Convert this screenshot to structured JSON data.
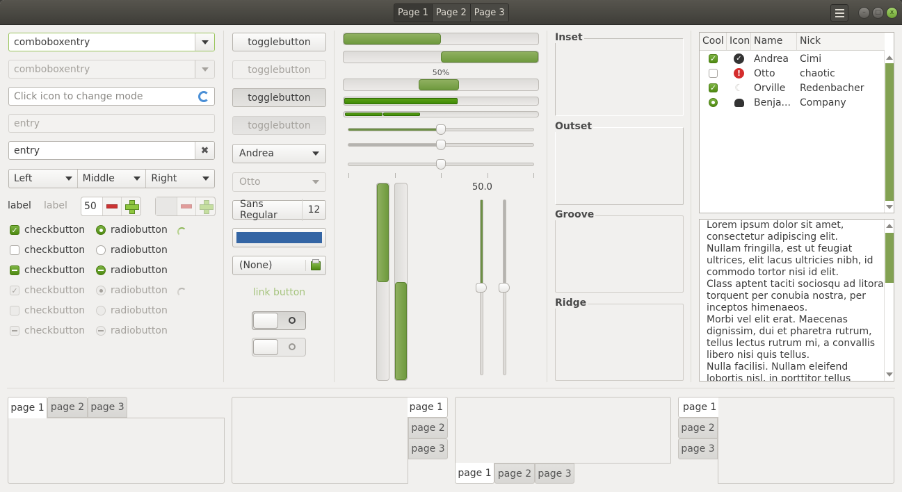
{
  "titlebar": {
    "stack_tabs": [
      "Page 1",
      "Page 2",
      "Page 3"
    ],
    "active_stack_tab": 0,
    "menu_icon": "hamburger-menu-icon",
    "window_buttons": [
      "minimize",
      "maximize",
      "close"
    ],
    "close_glyph": "x"
  },
  "entries": {
    "combo_entry_value": "comboboxentry",
    "combo_entry_disabled_value": "comboboxentry",
    "icon_entry_placeholder": "Click icon to change mode",
    "disabled_entry_value": "entry",
    "clear_entry_value": "entry",
    "clear_icon": "✖"
  },
  "combo_row": [
    {
      "label": "Left"
    },
    {
      "label": "Middle"
    },
    {
      "label": "Right"
    }
  ],
  "labels": {
    "label1": "label",
    "label2": "label"
  },
  "spin": {
    "value": "50",
    "disabled_value": ""
  },
  "checks": [
    {
      "label": "checkbutton",
      "state": "checked",
      "disabled": false
    },
    {
      "label": "checkbutton",
      "state": "unchecked",
      "disabled": false
    },
    {
      "label": "checkbutton",
      "state": "inconsistent",
      "disabled": false
    },
    {
      "label": "checkbutton",
      "state": "checked",
      "disabled": true
    },
    {
      "label": "checkbutton",
      "state": "unchecked",
      "disabled": true
    },
    {
      "label": "checkbutton",
      "state": "inconsistent",
      "disabled": true
    }
  ],
  "radios": [
    {
      "label": "radiobutton",
      "state": "checked",
      "disabled": false
    },
    {
      "label": "radiobutton",
      "state": "unchecked",
      "disabled": false
    },
    {
      "label": "radiobutton",
      "state": "inconsistent",
      "disabled": false
    },
    {
      "label": "radiobutton",
      "state": "checked",
      "disabled": true
    },
    {
      "label": "radiobutton",
      "state": "unchecked",
      "disabled": true
    },
    {
      "label": "radiobutton",
      "state": "inconsistent",
      "disabled": true
    }
  ],
  "toggles": [
    {
      "label": "togglebutton",
      "pressed": false,
      "disabled": false
    },
    {
      "label": "togglebutton",
      "pressed": false,
      "disabled": true
    },
    {
      "label": "togglebutton",
      "pressed": true,
      "disabled": false
    },
    {
      "label": "togglebutton",
      "pressed": true,
      "disabled": true
    }
  ],
  "combos": {
    "andrea": "Andrea",
    "otto": "Otto"
  },
  "font_button": {
    "font": "Sans Regular",
    "size": "12"
  },
  "color_button": {
    "color": "#3465a4"
  },
  "file_button": {
    "label": "(None)"
  },
  "link_button": {
    "label": "link button"
  },
  "switches": [
    {
      "active": false,
      "disabled": false
    },
    {
      "active": false,
      "disabled": true
    }
  ],
  "progress": {
    "bar1_fraction": 0.5,
    "bar2_fraction": 0.5,
    "bar2_inverted": true,
    "bar3_text": "50%",
    "bar3_pulse": true,
    "bar4_fraction": 0.59,
    "bar5_segments": 2
  },
  "scales": {
    "h1_value": 0.5,
    "h2_value": 0.5,
    "h3_value": 0.5,
    "marks": 5,
    "v_value_label": "50.0",
    "v1_value": 0.5,
    "v2_value": 0.5,
    "vbar1_fraction": 0.5,
    "vbar2_fraction": 0.5
  },
  "frames": [
    {
      "title": "Inset"
    },
    {
      "title": "Outset"
    },
    {
      "title": "Groove"
    },
    {
      "title": "Ridge"
    }
  ],
  "tree": {
    "columns": [
      "Cool",
      "Icon",
      "Name",
      "Nick"
    ],
    "rows": [
      {
        "cool": "checked",
        "icon": "checkmark-circle-icon",
        "name": "Andrea",
        "nick": "Cimi"
      },
      {
        "cool": "unchecked",
        "icon": "error-icon",
        "name": "Otto",
        "nick": "chaotic"
      },
      {
        "cool": "checked",
        "icon": "moon-icon",
        "name": "Orville",
        "nick": "Redenbacher"
      },
      {
        "cool": "radio",
        "icon": "monkey-icon",
        "name": "Benja...",
        "nick": "Company"
      }
    ]
  },
  "textview": {
    "text": "Lorem ipsum dolor sit amet,\nconsectetur adipiscing elit.\nNullam fringilla, est ut feugiat\nultrices, elit lacus ultricies nibh, id\ncommodo tortor nisi id elit.\nClass aptent taciti sociosqu ad litora\ntorquent per conubia nostra, per\ninceptos himenaeos.\nMorbi vel elit erat. Maecenas\ndignissim, dui et pharetra rutrum,\ntellus lectus rutrum mi, a convallis\nlibero nisi quis tellus.\nNulla facilisi. Nullam eleifend\nlobortis nisl, in porttitor tellus"
  },
  "notebooks": [
    {
      "position": "top",
      "tabs": [
        "page 1",
        "page 2",
        "page 3"
      ],
      "active": 0
    },
    {
      "position": "right",
      "tabs": [
        "page 1",
        "page 2",
        "page 3"
      ],
      "active": 0
    },
    {
      "position": "bottom",
      "tabs": [
        "page 1",
        "page 2",
        "page 3"
      ],
      "active": 0
    },
    {
      "position": "left",
      "tabs": [
        "page 1",
        "page 2",
        "page 3"
      ],
      "active": 0
    }
  ],
  "colors": {
    "accent": "#7aa33e",
    "scroll_thumb": "#82a152",
    "progress_bright": "#4e9a06"
  }
}
